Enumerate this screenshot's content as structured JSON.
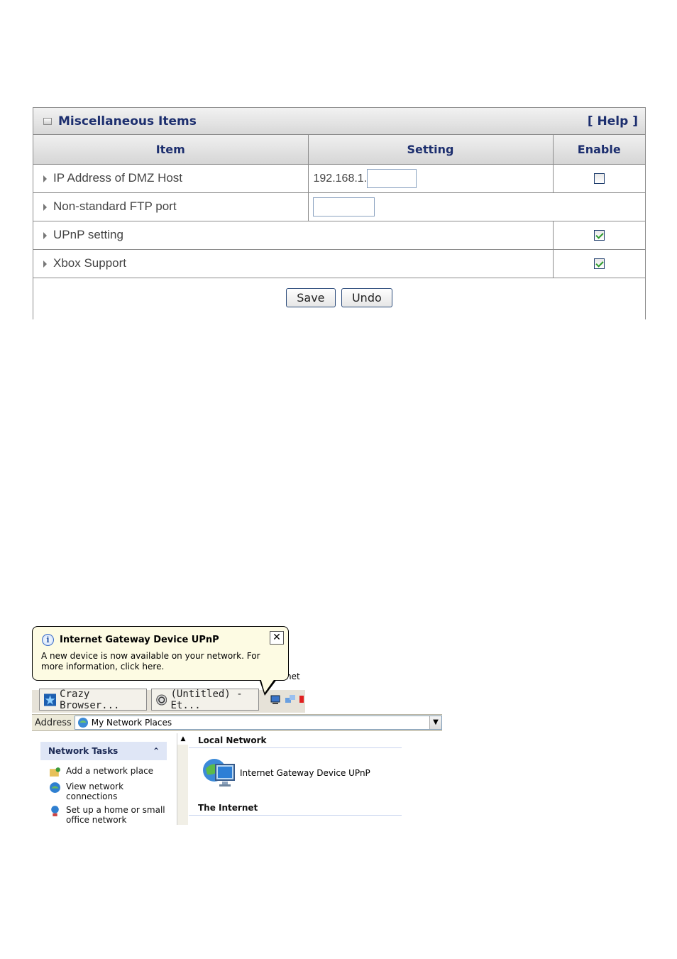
{
  "router_panel": {
    "title": "Miscellaneous Items",
    "help": "[ Help ]",
    "headers": {
      "item": "Item",
      "setting": "Setting",
      "enable": "Enable"
    },
    "rows": [
      {
        "label": "IP Address of DMZ Host",
        "prefix": "192.168.1.",
        "input_value": "",
        "enabled": false
      },
      {
        "label": "Non-standard FTP port",
        "input_value": ""
      },
      {
        "label": "UPnP setting",
        "enabled": true
      },
      {
        "label": "Xbox Support",
        "enabled": true
      }
    ],
    "save_label": "Save",
    "undo_label": "Undo"
  },
  "xp": {
    "balloon": {
      "title": "Internet Gateway Device UPnP",
      "message": "A new device is now available on your network. For more information, click here.",
      "close": "✕"
    },
    "taskbar": {
      "partial_text": "net",
      "buttons": [
        "Crazy Browser...",
        "(Untitled) - Et..."
      ]
    },
    "address": {
      "label": "Address",
      "value": "My Network Places"
    },
    "tasks": {
      "title": "Network Tasks",
      "items": [
        "Add a network place",
        "View network connections",
        "Set up a home or small office network"
      ]
    },
    "content": {
      "group1": "Local Network",
      "device": "Internet Gateway Device UPnP",
      "group2": "The Internet"
    },
    "colors": {
      "balloon_bg": "#fdfbe3",
      "panel_title": "#1c2e6e",
      "checkmark": "#2a9a2a"
    }
  }
}
